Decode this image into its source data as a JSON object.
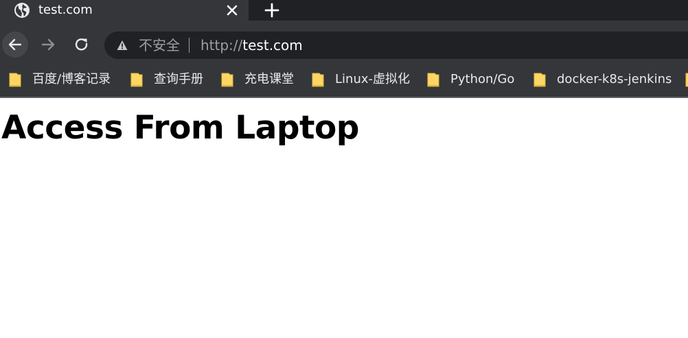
{
  "tab": {
    "title": "test.com",
    "favicon": "globe-icon"
  },
  "toolbar": {
    "security_label": "不安全",
    "url_scheme": "http://",
    "url_host": "test.com",
    "icons": [
      "back-arrow-icon",
      "forward-arrow-icon",
      "reload-icon",
      "warning-triangle-icon"
    ]
  },
  "bookmarks": [
    {
      "label": "百度/博客记录",
      "icon": "folder-icon"
    },
    {
      "label": "查询手册",
      "icon": "folder-icon"
    },
    {
      "label": "充电课堂",
      "icon": "folder-icon"
    },
    {
      "label": "Linux-虚拟化",
      "icon": "folder-icon"
    },
    {
      "label": "Python/Go",
      "icon": "folder-icon"
    },
    {
      "label": "docker-k8s-jenkins",
      "icon": "folder-icon"
    }
  ],
  "page": {
    "heading": "Access From Laptop"
  },
  "colors": {
    "tabstrip": "#202124",
    "toolbar": "#35363a",
    "omnibox": "#202124",
    "folder_fill": "#fdd663"
  }
}
